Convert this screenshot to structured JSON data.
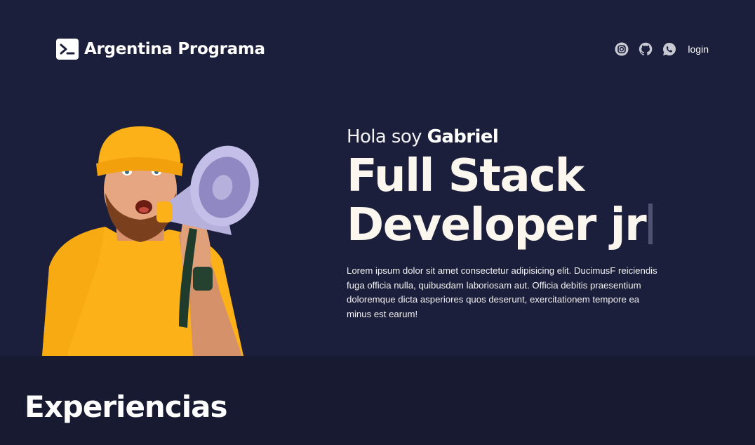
{
  "navbar": {
    "brand_name": "Argentina Programa",
    "brand_icon": "terminal-icon",
    "social_icons": [
      "instagram-icon",
      "github-icon",
      "whatsapp-icon"
    ],
    "login_label": "login"
  },
  "hero": {
    "greeting_prefix": "Hola soy",
    "name": "Gabriel",
    "role_line1": "Full Stack",
    "role_line2": "Developer jr",
    "description": "Lorem ipsum dolor sit amet consectetur adipisicing elit. DucimusF reiciendis fuga officia nulla, quibusdam laboriosam aut. Officia debitis praesentium doloremque dicta asperiores quos deserunt, exercitationem tempore ea minus est earum!",
    "image": "man-with-megaphone-photo"
  },
  "experiences": {
    "title": "Experiencias"
  },
  "colors": {
    "background": "#1c1f3b",
    "section_background": "#171a31",
    "accent_yellow": "#fbb117",
    "icon_gray": "#c9c9d4"
  }
}
